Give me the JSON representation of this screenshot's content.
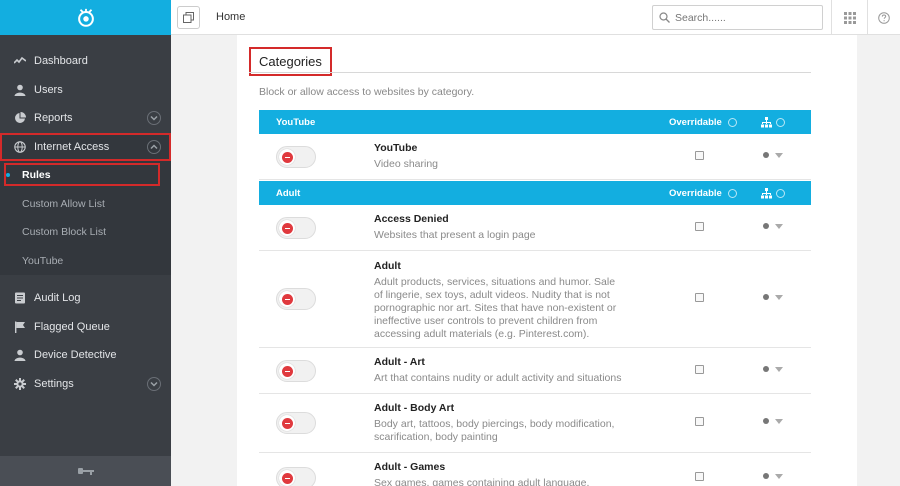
{
  "breadcrumb": "Home",
  "search": {
    "placeholder": "Search......"
  },
  "sidebar": {
    "items": [
      {
        "label": "Dashboard",
        "icon": "activity-icon"
      },
      {
        "label": "Users",
        "icon": "user-icon"
      },
      {
        "label": "Reports",
        "icon": "pie-chart-icon"
      },
      {
        "label": "Internet Access",
        "icon": "globe-icon"
      }
    ],
    "internet_access_sub": [
      {
        "label": "Rules"
      },
      {
        "label": "Custom Allow List"
      },
      {
        "label": "Custom Block List"
      },
      {
        "label": "YouTube"
      }
    ],
    "items2": [
      {
        "label": "Audit Log",
        "icon": "list-icon"
      },
      {
        "label": "Flagged Queue",
        "icon": "flag-icon"
      },
      {
        "label": "Device Detective",
        "icon": "user-search-icon"
      },
      {
        "label": "Settings",
        "icon": "gear-icon"
      }
    ]
  },
  "page": {
    "title": "Categories",
    "subtitle": "Block or allow access to websites by category."
  },
  "sections": [
    {
      "header": "YouTube",
      "overridable_label": "Overridable",
      "rows": [
        {
          "title": "YouTube",
          "desc": "Video sharing"
        }
      ]
    },
    {
      "header": "Adult",
      "overridable_label": "Overridable",
      "rows": [
        {
          "title": "Access Denied",
          "desc": "Websites that present a login page"
        },
        {
          "title": "Adult",
          "desc": "Adult products, services, situations and humor. Sale of lingerie, sex toys, adult videos. Nudity that is not pornographic nor art. Sites that have non-existent or ineffective user controls to prevent children from accessing adult materials (e.g. Pinterest.com)."
        },
        {
          "title": "Adult - Art",
          "desc": "Art that contains nudity or adult activity and situations"
        },
        {
          "title": "Adult - Body Art",
          "desc": "Body art, tattoos, body piercings, body modification, scarification, body painting"
        },
        {
          "title": "Adult - Games",
          "desc": "Sex games, games containing adult language, situations,"
        }
      ]
    }
  ],
  "colors": {
    "accent": "#13aee0",
    "sidebar": "#3a3e44",
    "highlight": "#d42a2a",
    "blocked": "#e0393e"
  }
}
